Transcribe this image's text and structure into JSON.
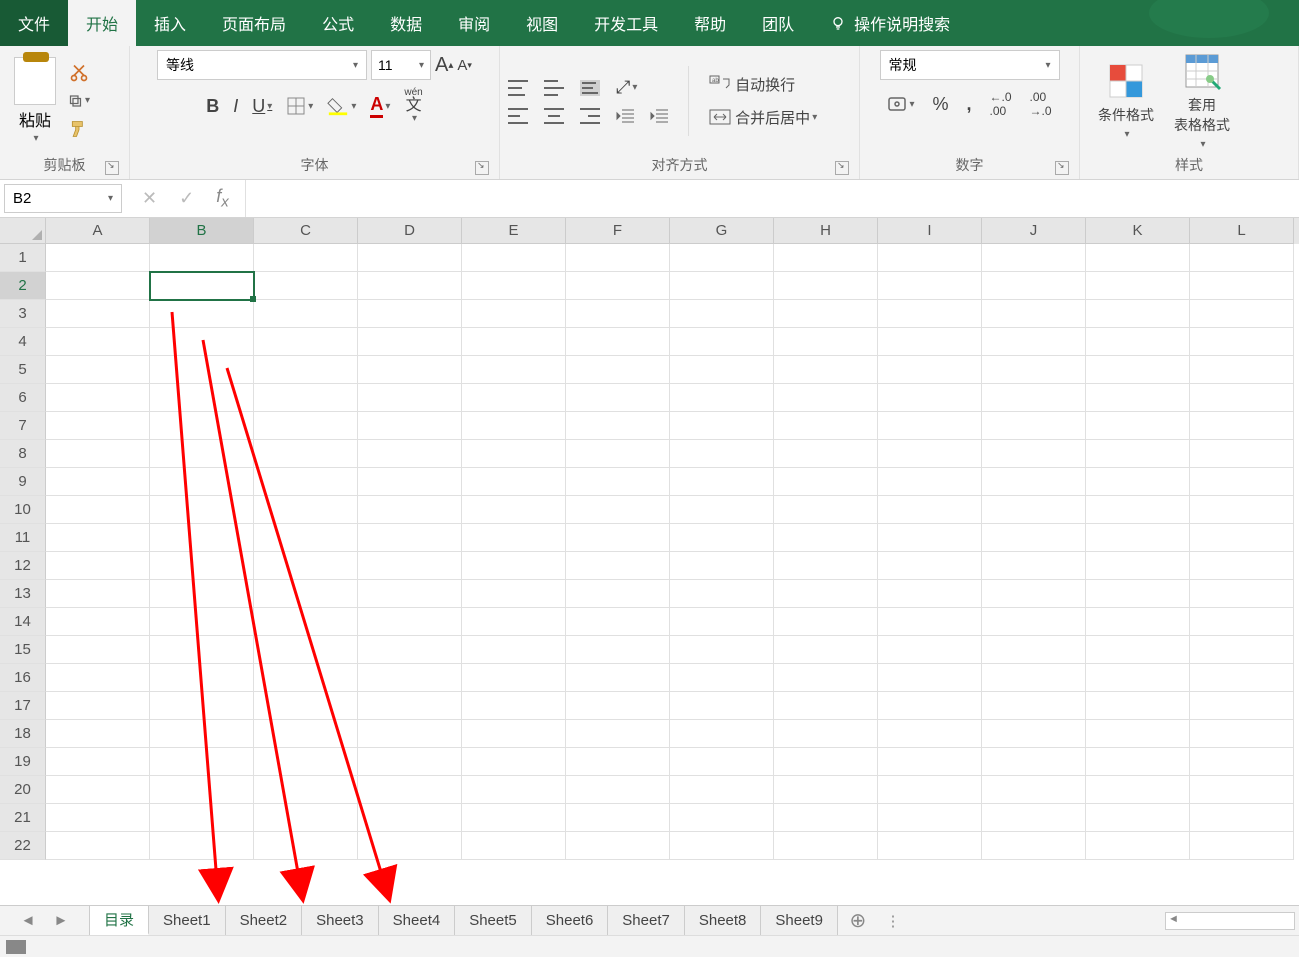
{
  "tabs": {
    "file": "文件",
    "home": "开始",
    "insert": "插入",
    "layout": "页面布局",
    "formula": "公式",
    "data": "数据",
    "review": "审阅",
    "view": "视图",
    "dev": "开发工具",
    "help": "帮助",
    "team": "团队",
    "tellme": "操作说明搜索"
  },
  "clipboard": {
    "paste": "粘贴",
    "group": "剪贴板"
  },
  "font": {
    "name": "等线",
    "size": "11",
    "group": "字体",
    "wen": "wén",
    "wenchar": "文"
  },
  "alignment": {
    "wrap": "自动换行",
    "merge": "合并后居中",
    "group": "对齐方式"
  },
  "number": {
    "format": "常规",
    "group": "数字"
  },
  "styles": {
    "cond": "条件格式",
    "table": "套用\n表格格式",
    "group": "样式"
  },
  "namebox": "B2",
  "columns": [
    "A",
    "B",
    "C",
    "D",
    "E",
    "F",
    "G",
    "H",
    "I",
    "J",
    "K",
    "L"
  ],
  "rows": [
    "1",
    "2",
    "3",
    "4",
    "5",
    "6",
    "7",
    "8",
    "9",
    "10",
    "11",
    "12",
    "13",
    "14",
    "15",
    "16",
    "17",
    "18",
    "19",
    "20",
    "21",
    "22"
  ],
  "selected": {
    "col": 1,
    "row": 1
  },
  "sheets": {
    "active": "目录",
    "list": [
      "Sheet1",
      "Sheet2",
      "Sheet3",
      "Sheet4",
      "Sheet5",
      "Sheet6",
      "Sheet7",
      "Sheet8",
      "Sheet9"
    ]
  }
}
